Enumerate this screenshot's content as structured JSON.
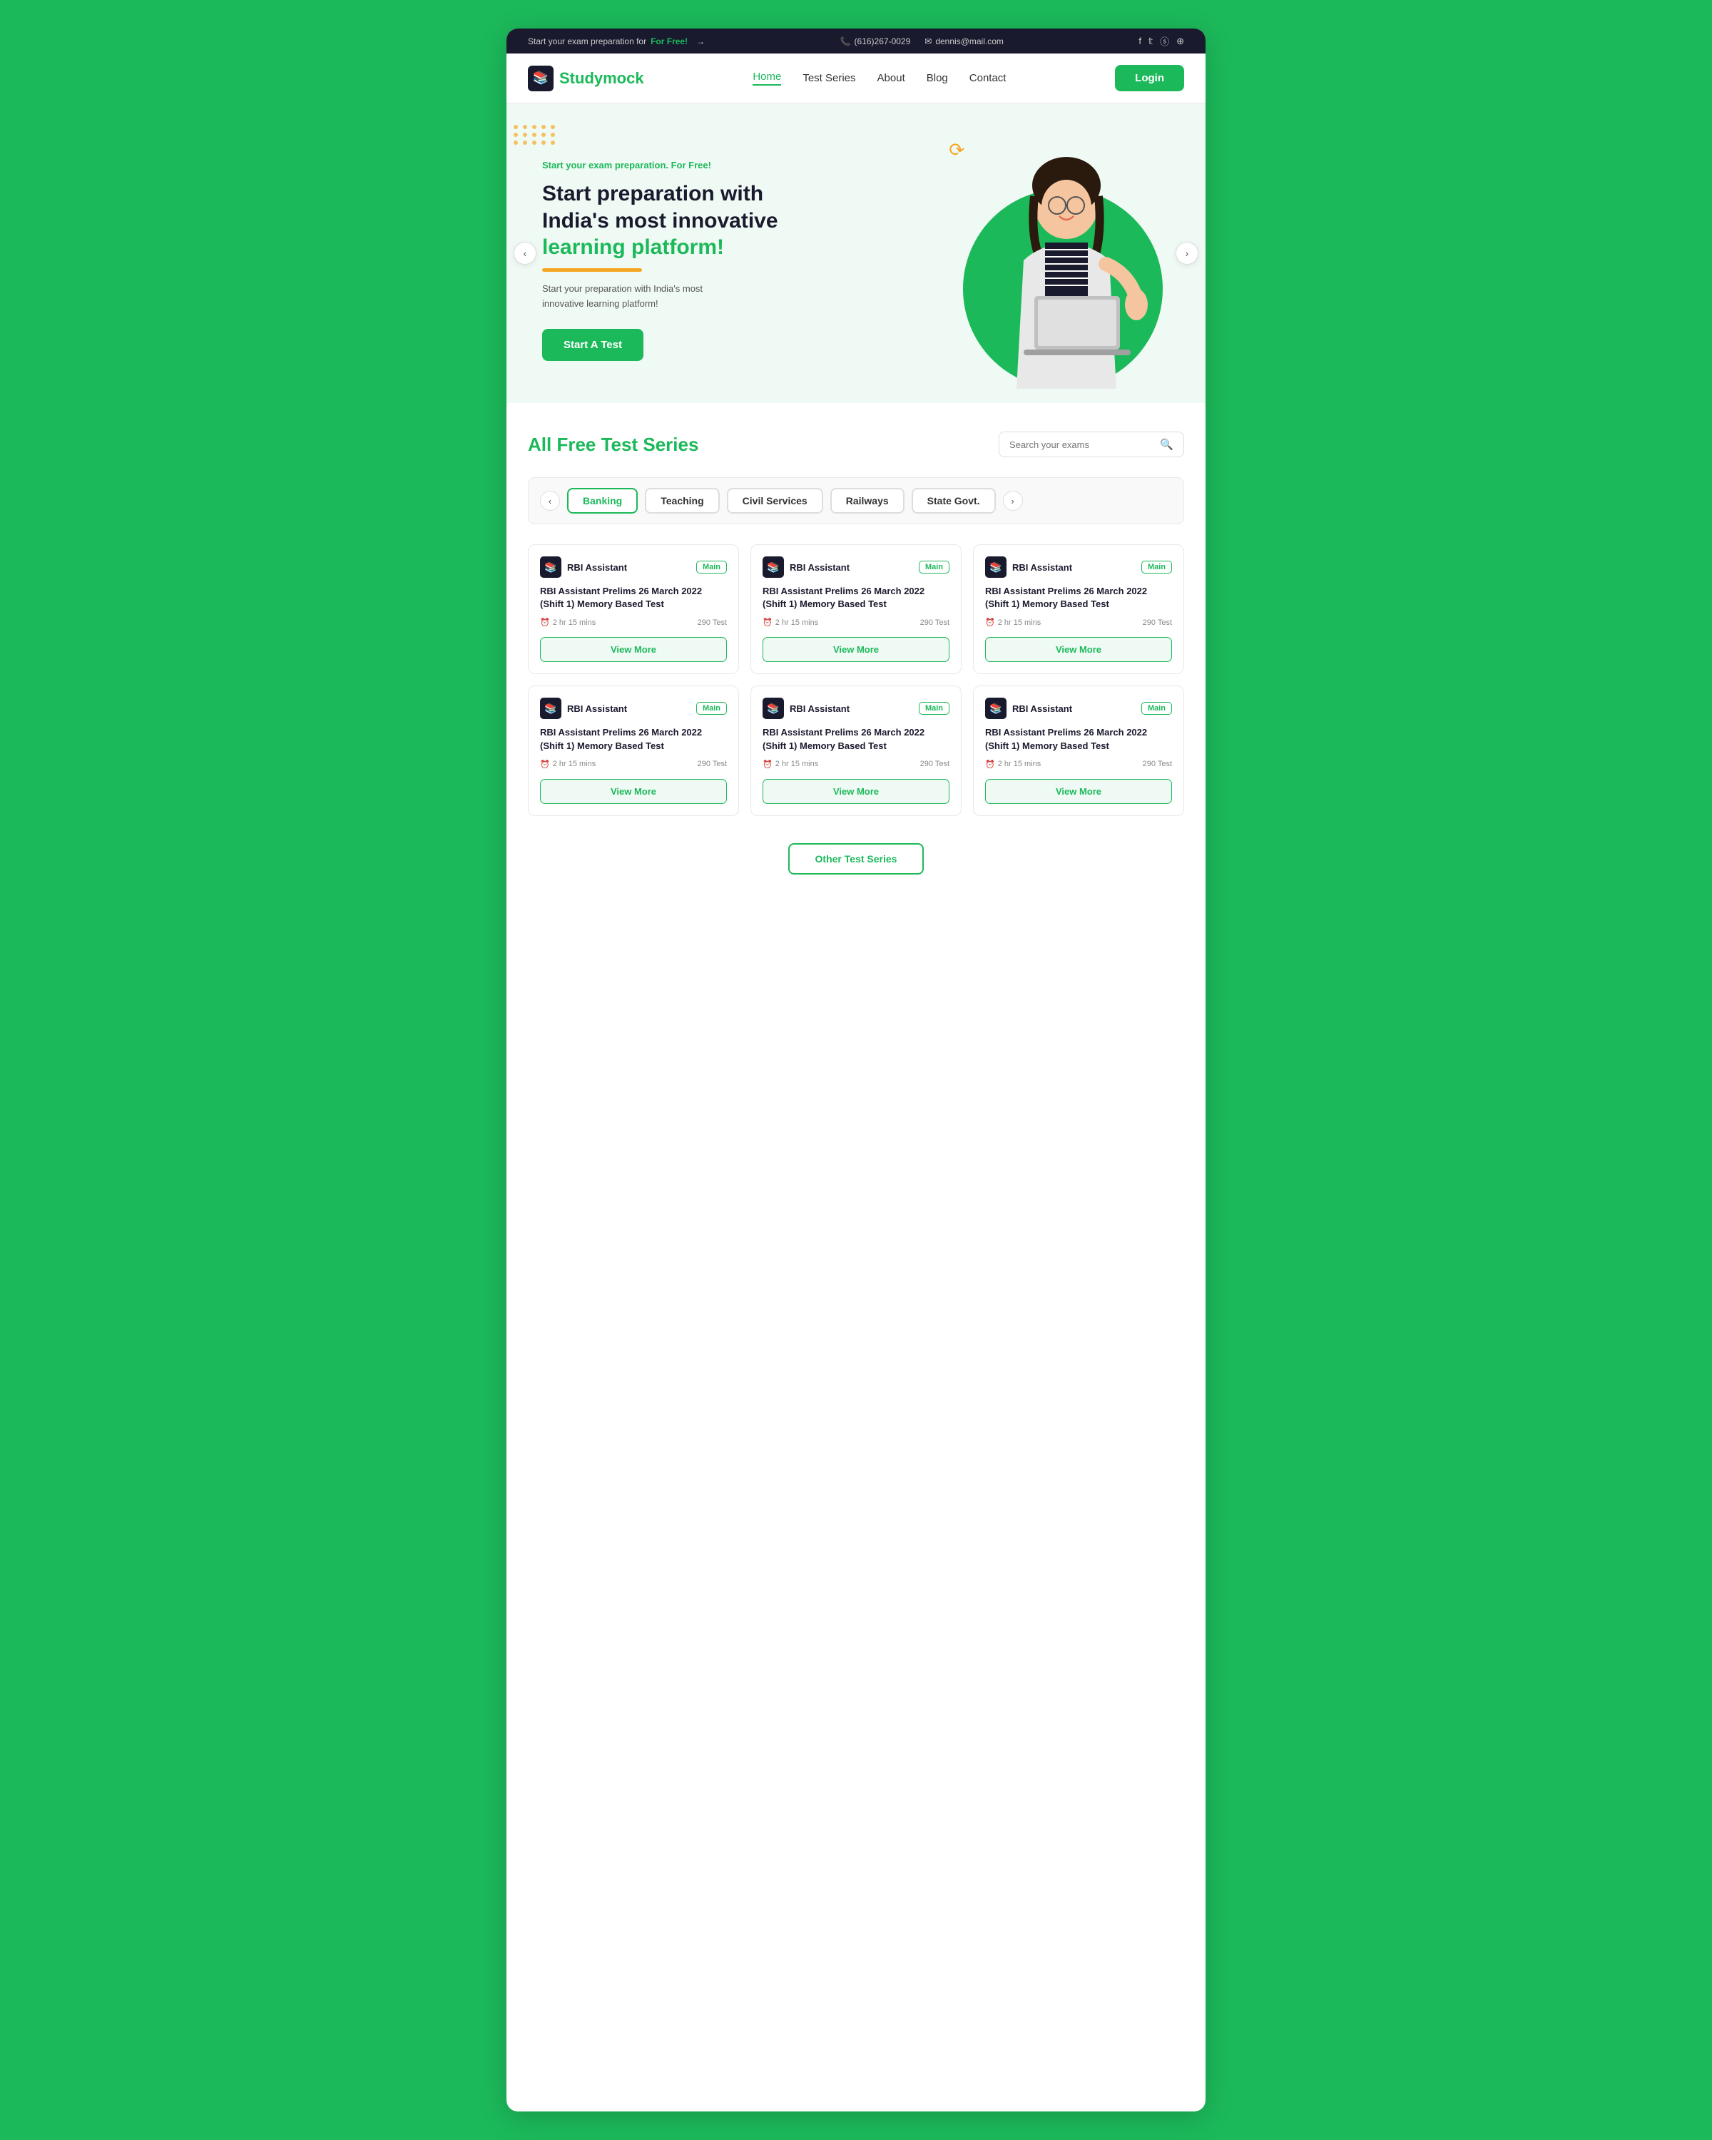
{
  "topbar": {
    "promo_text": "Start your exam preparation for ",
    "promo_highlight": "For Free!",
    "phone": "(616)267-0029",
    "email": "dennis@mail.com",
    "socials": [
      "f",
      "t",
      "s",
      "i"
    ]
  },
  "navbar": {
    "logo_text_1": "Study",
    "logo_text_2": "mock",
    "links": [
      {
        "label": "Home",
        "active": true
      },
      {
        "label": "Test Series",
        "active": false
      },
      {
        "label": "About",
        "active": false
      },
      {
        "label": "Blog",
        "active": false
      },
      {
        "label": "Contact",
        "active": false
      }
    ],
    "login_label": "Login"
  },
  "hero": {
    "tagline": "Start your exam preparation. For Free!",
    "title_1": "Start preparation with\nIndia's most innovative",
    "title_2": "learning platform!",
    "description": "Start your preparation with India's most\ninnovative learning platform!",
    "cta_label": "Start A Test",
    "prev_label": "‹",
    "next_label": "›"
  },
  "test_section": {
    "title_1": "All Free ",
    "title_2": "Test Series",
    "search_placeholder": "Search your exams",
    "tabs": [
      {
        "label": "Banking",
        "active": true
      },
      {
        "label": "Teaching",
        "active": false
      },
      {
        "label": "Civil Services",
        "active": false
      },
      {
        "label": "Railways",
        "active": false
      },
      {
        "label": "State Govt.",
        "active": false
      }
    ],
    "cards": [
      {
        "org": "RBI Assistant",
        "badge": "Main",
        "title": "RBI Assistant Prelims 26 March 2022 (Shift 1) Memory Based Test",
        "time": "2 hr 15 mins",
        "tests": "290 Test",
        "btn_label": "View More"
      },
      {
        "org": "RBI Assistant",
        "badge": "Main",
        "title": "RBI Assistant Prelims 26 March 2022 (Shift 1) Memory Based Test",
        "time": "2 hr 15 mins",
        "tests": "290 Test",
        "btn_label": "View More"
      },
      {
        "org": "RBI Assistant",
        "badge": "Main",
        "title": "RBI Assistant Prelims 26 March 2022 (Shift 1) Memory Based Test",
        "time": "2 hr 15 mins",
        "tests": "290 Test",
        "btn_label": "View More"
      },
      {
        "org": "RBI Assistant",
        "badge": "Main",
        "title": "RBI Assistant Prelims 26 March 2022 (Shift 1) Memory Based Test",
        "time": "2 hr 15 mins",
        "tests": "290 Test",
        "btn_label": "View More"
      },
      {
        "org": "RBI Assistant",
        "badge": "Main",
        "title": "RBI Assistant Prelims 26 March 2022 (Shift 1) Memory Based Test",
        "time": "2 hr 15 mins",
        "tests": "290 Test",
        "btn_label": "View More"
      },
      {
        "org": "RBI Assistant",
        "badge": "Main",
        "title": "RBI Assistant Prelims 26 March 2022 (Shift 1) Memory Based Test",
        "time": "2 hr 15 mins",
        "tests": "290 Test",
        "btn_label": "View More"
      }
    ],
    "other_btn_label": "Other Test Series"
  }
}
